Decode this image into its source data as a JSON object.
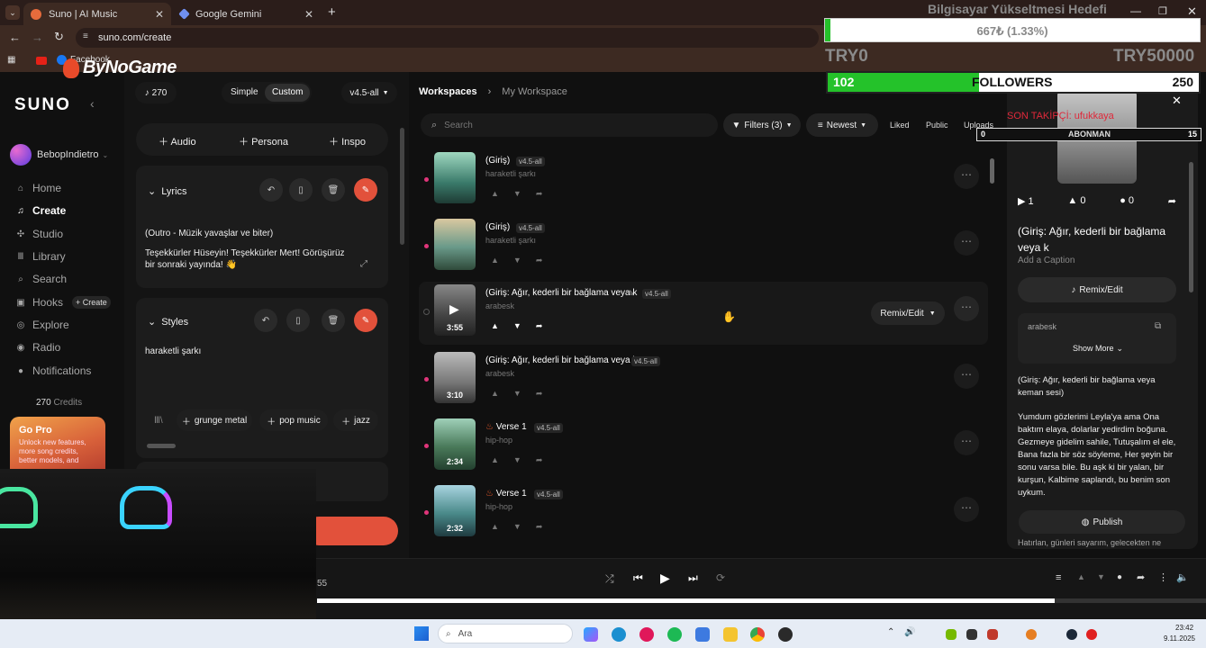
{
  "browser": {
    "tabs": [
      {
        "label": "Suno | AI Music"
      },
      {
        "label": "Google Gemini"
      }
    ],
    "url": "suno.com/create",
    "bookmarks": [
      "Facebook"
    ]
  },
  "overlay": {
    "goal_title": "Bilgisayar Yükseltmesi Hedefi",
    "goal_value": "667₺ (1.33%)",
    "goal_progress": 0.0133,
    "goal_min": "TRY0",
    "goal_max": "TRY50000",
    "followers_current": "102",
    "followers_label": "FOLLOWERS",
    "followers_target": "250",
    "followers_progress": 0.408,
    "last_sub": "SON TAKİPÇİ: ufukkaya",
    "sub_min": "0",
    "sub_label": "ABONMAN",
    "sub_max": "15",
    "logo": "ByNoGame"
  },
  "sidebar": {
    "brand": "SUNO",
    "user": "BebopIndietro",
    "items": [
      {
        "label": "Home",
        "icon": "home-icon"
      },
      {
        "label": "Create",
        "icon": "create-icon"
      },
      {
        "label": "Studio",
        "icon": "studio-icon"
      },
      {
        "label": "Library",
        "icon": "library-icon"
      },
      {
        "label": "Search",
        "icon": "search-icon"
      },
      {
        "label": "Hooks",
        "icon": "hooks-icon"
      },
      {
        "label": "Explore",
        "icon": "explore-icon"
      },
      {
        "label": "Radio",
        "icon": "radio-icon"
      },
      {
        "label": "Notifications",
        "icon": "bell-icon"
      }
    ],
    "hooks_create": "+ Create",
    "credits_value": "270",
    "credits_label": "Credits",
    "gopro_title": "Go Pro",
    "gopro_text": "Unlock new features, more song credits, better models, and"
  },
  "create": {
    "credits": "270",
    "mode_simple": "Simple",
    "mode_custom": "Custom",
    "model": "v4.5-all",
    "add_audio": "Audio",
    "add_persona": "Persona",
    "add_inspo": "Inspo",
    "lyrics_label": "Lyrics",
    "lyrics_line1": "(Outro - Müzik yavaşlar ve biter)",
    "lyrics_line2": "Teşekkürler Hüseyin! Teşekkürler Mert! Görüşürüz bir sonraki yayında! 👋",
    "styles_label": "Styles",
    "styles_value": "haraketli şarkı",
    "tags": [
      "grunge metal",
      "pop music",
      "jazz"
    ]
  },
  "workspace": {
    "breadcrumb_root": "Workspaces",
    "breadcrumb_current": "My Workspace",
    "search_placeholder": "Search",
    "filters": "Filters (3)",
    "sort": "Newest",
    "liked": "Liked",
    "public": "Public",
    "uploads": "Uploads",
    "remix_edit": "Remix/Edit",
    "songs": [
      {
        "title": "(Giriş)",
        "version": "v4.5-all",
        "genre": "haraketli şarkı",
        "duration": ""
      },
      {
        "title": "(Giriş)",
        "version": "v4.5-all",
        "genre": "haraketli şarkı",
        "duration": ""
      },
      {
        "title": "(Giriş: Ağır, kederli bir bağlama veya k",
        "version": "v4.5-all",
        "genre": "arabesk",
        "duration": "3:55"
      },
      {
        "title": "(Giriş: Ağır, kederli bir bağlama veya k",
        "version": "v4.5-all",
        "genre": "arabesk",
        "duration": "3:10"
      },
      {
        "title": "Verse 1",
        "version": "v4.5-all",
        "genre": "hip-hop",
        "duration": "2:34"
      },
      {
        "title": "Verse 1",
        "version": "v4.5-all",
        "genre": "hip-hop",
        "duration": "2:32"
      }
    ]
  },
  "detail": {
    "plays": "1",
    "likes": "0",
    "comments": "0",
    "title": "(Giriş: Ağır, kederli bir bağlama veya k",
    "caption": "Add a Caption",
    "remix": "Remix/Edit",
    "style": "arabesk",
    "show_more": "Show More",
    "lyrics_title": "(Giriş: Ağır, kederli bir bağlama veya keman sesi)",
    "lyrics": "Yumdum gözlerimi Leyla'ya ama Ona baktım elaya, dolarlar yedirdim boğuna. Gezmeye gidelim sahile, Tutuşalım el ele, Bana fazla bir söz söyleme, Her şeyin bir sonu varsa bile. Bu aşk ki bir yalan, bir kurşun, Kalbime saplandı, bu benim son uykum.",
    "publish": "Publish",
    "cut_text": "Hatırlan, günleri sayarım, gelecekten ne"
  },
  "player": {
    "time": "55",
    "progress": 0.83
  },
  "taskbar": {
    "search": "Ara",
    "time": "23:42",
    "date": "9.11.2025"
  }
}
